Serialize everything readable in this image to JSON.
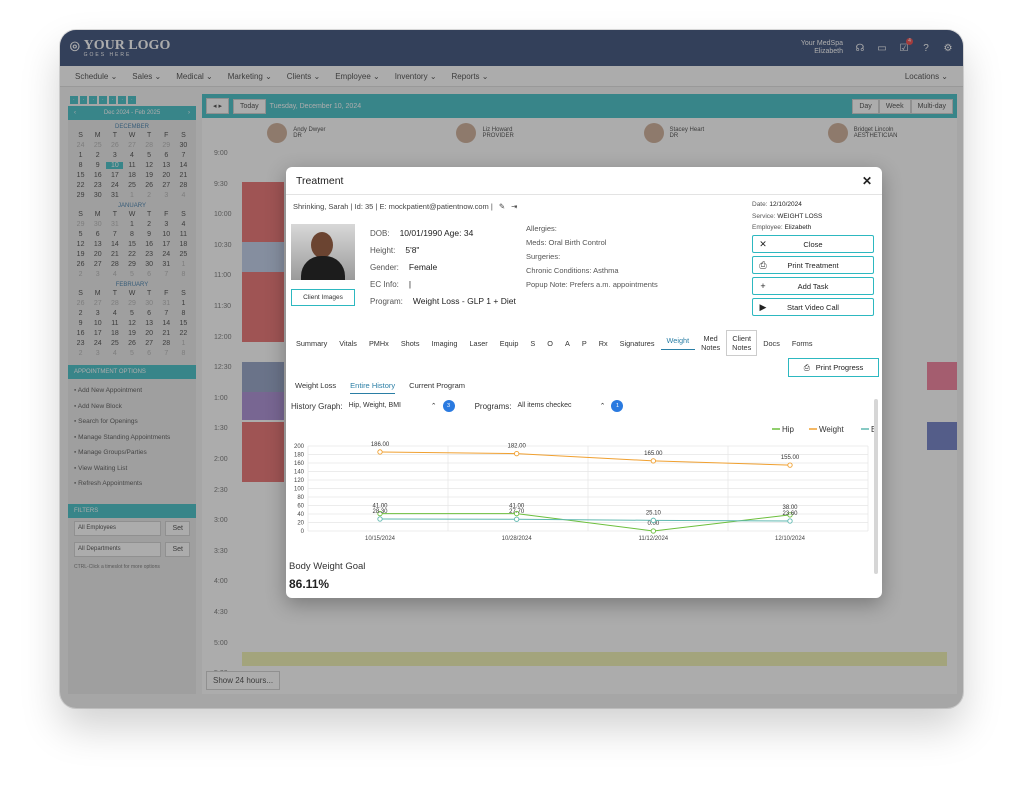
{
  "topbar": {
    "logo_main": "YOUR LOGO",
    "logo_sub": "GOES HERE",
    "spa_name": "Your MedSpa",
    "user_name": "Elizabeth",
    "task_badge": "4"
  },
  "nav": {
    "items": [
      "Schedule ⌄",
      "Sales ⌄",
      "Medical ⌄",
      "Marketing ⌄",
      "Clients ⌄",
      "Employee ⌄",
      "Inventory ⌄",
      "Reports ⌄"
    ],
    "locations": "Locations ⌄"
  },
  "calendar": {
    "range": "Dec 2024 - Feb 2025",
    "months": [
      "DECEMBER",
      "JANUARY",
      "FEBRUARY"
    ],
    "dow": [
      "S",
      "M",
      "T",
      "W",
      "T",
      "F",
      "S"
    ]
  },
  "appointment_options": {
    "title": "APPOINTMENT OPTIONS",
    "items": [
      "Add New Appointment",
      "Add New Block",
      "Search for Openings",
      "Manage Standing Appointments",
      "Manage Groups/Parties",
      "View Waiting List",
      "Refresh Appointments"
    ]
  },
  "filters": {
    "title": "FILTERS",
    "employees": "All Employees",
    "departments": "All Departments",
    "set": "Set",
    "hint": "CTRL-Click a timeslot for more options"
  },
  "schedule": {
    "today": "Today",
    "date": "Tuesday, December 10, 2024",
    "views": [
      "Day",
      "Week",
      "Multi-day"
    ],
    "providers": [
      {
        "name": "Andy Dwyer",
        "role": "DR"
      },
      {
        "name": "Liz Howard",
        "role": "PROVIDER"
      },
      {
        "name": "Stacey Heart",
        "role": "DR"
      },
      {
        "name": "Bridget Lincoln",
        "role": "AESTHETICIAN"
      }
    ],
    "times": [
      "9:00",
      "9:30",
      "10:00",
      "10:30",
      "11:00",
      "11:30",
      "12:00",
      "12:30",
      "1:00",
      "1:30",
      "2:00",
      "2:30",
      "3:00",
      "3:30",
      "4:00",
      "4:30",
      "5:00",
      "5:30"
    ],
    "show24": "Show 24 hours..."
  },
  "modal": {
    "title": "Treatment",
    "patient_line": "Shrinking, Sarah | Id: 35 | E: mockpatient@patientnow.com |",
    "client_images": "Client Images",
    "info": {
      "dob_label": "DOB:",
      "dob": "10/01/1990 Age: 34",
      "height_label": "Height:",
      "height": "5'8\"",
      "gender_label": "Gender:",
      "gender": "Female",
      "ec_label": "EC Info:",
      "ec": "|",
      "program_label": "Program:",
      "program": "Weight Loss - GLP 1 + Diet"
    },
    "info2": {
      "allergies": "Allergies:",
      "meds": "Meds: Oral Birth Control",
      "surgeries": "Surgeries:",
      "chronic": "Chronic Conditions: Asthma",
      "popup": "Popup Note: Prefers a.m. appointments"
    },
    "right": {
      "date_label": "Date:",
      "date": "12/10/2024",
      "service_label": "Service:",
      "service": "WEIGHT LOSS",
      "employee_label": "Employee:",
      "employee": "Elizabeth"
    },
    "buttons": {
      "close": "Close",
      "print_treatment": "Print Treatment",
      "add_task": "Add Task",
      "video_call": "Start Video Call",
      "print_progress": "Print Progress"
    },
    "tabs": [
      "Summary",
      "Vitals",
      "PMHx",
      "Shots",
      "Imaging",
      "Laser",
      "Equip",
      "S",
      "O",
      "A",
      "P",
      "Rx",
      "Signatures",
      "Weight",
      "Med Notes",
      "Client Notes",
      "Docs",
      "Forms"
    ],
    "subtabs": [
      "Weight Loss",
      "Entire History",
      "Current Program"
    ],
    "history_label": "History Graph:",
    "history_value": "Hip, Weight, BMI",
    "history_count": "3",
    "programs_label": "Programs:",
    "programs_value": "All items checkec",
    "programs_count": "1",
    "goal_label": "Body Weight Goal",
    "goal_value": "86.11%"
  },
  "chart_data": {
    "type": "line",
    "x": [
      "10/15/2024",
      "10/28/2024",
      "11/12/2024",
      "12/10/2024"
    ],
    "series": [
      {
        "name": "Hip",
        "color": "#6cbf3c",
        "values": [
          41.0,
          41.0,
          0,
          38.0
        ]
      },
      {
        "name": "Weight",
        "color": "#f0a030",
        "values": [
          186.0,
          182.0,
          165.0,
          155.0
        ]
      },
      {
        "name": "BMI",
        "color": "#5fb8b0",
        "values": [
          28.3,
          27.7,
          25.1,
          23.6
        ]
      }
    ],
    "labels": {
      "Weight": [
        "186.00",
        "182.00",
        "165.00",
        "155.00"
      ],
      "Hip": [
        "41.00",
        "41.00",
        "0.00",
        "38.00"
      ],
      "BMI": [
        "28.30",
        "27.70",
        "25.10",
        "23.60"
      ]
    },
    "ylim": [
      0,
      200
    ],
    "yticks": [
      0,
      20,
      40,
      60,
      80,
      100,
      120,
      140,
      160,
      180,
      200
    ],
    "grid": true,
    "legend": "top-right"
  }
}
